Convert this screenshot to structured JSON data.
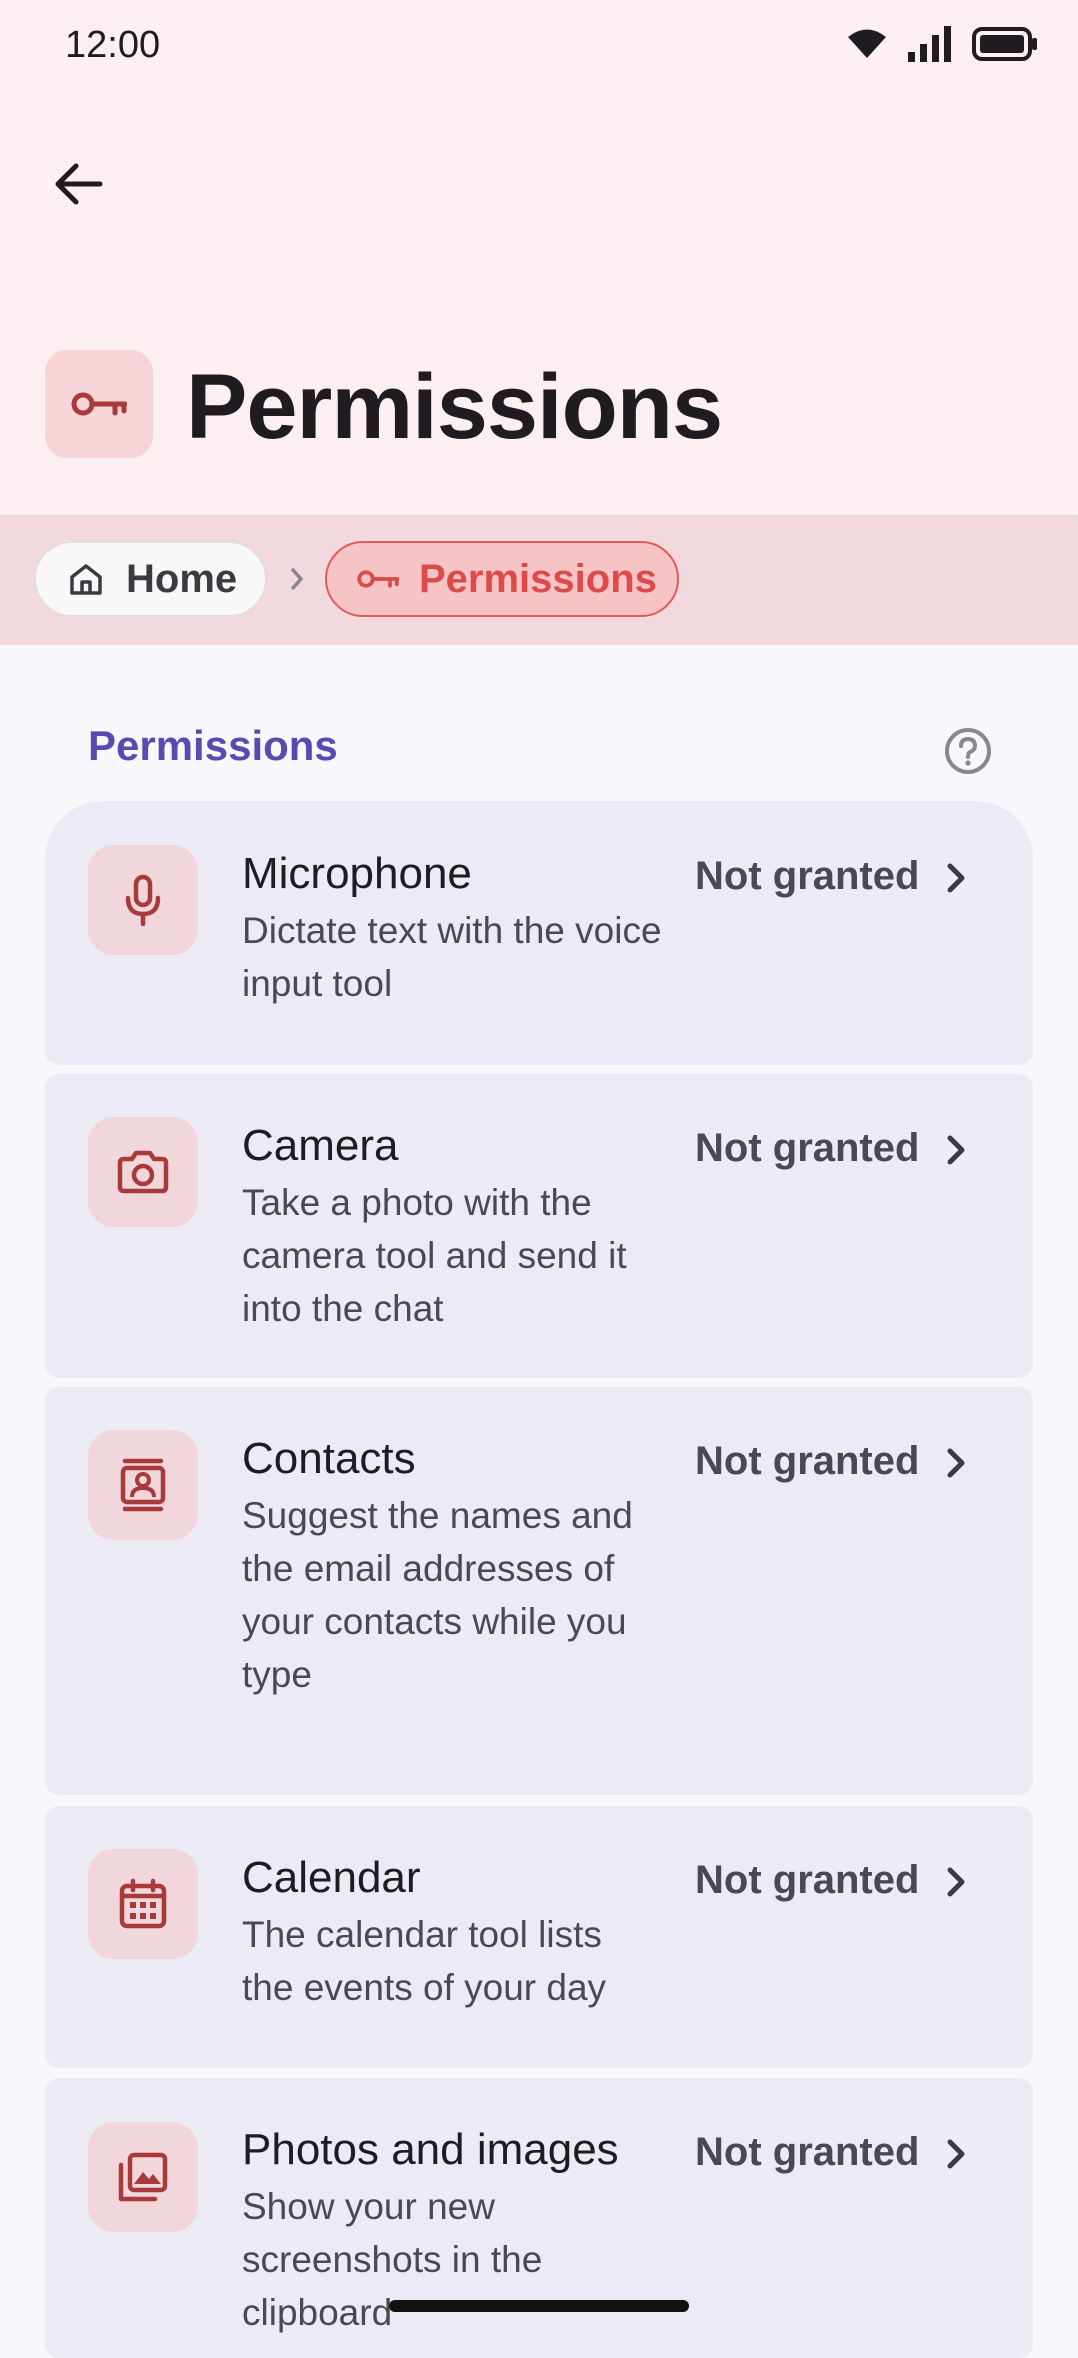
{
  "status_bar": {
    "time": "12:00"
  },
  "header": {
    "title": "Permissions"
  },
  "breadcrumb": {
    "home_label": "Home",
    "current_label": "Permissions"
  },
  "section": {
    "label": "Permissions"
  },
  "permissions": [
    {
      "title": "Microphone",
      "description": "Dictate text with the voice input tool",
      "status": "Not granted",
      "icon": "microphone-icon"
    },
    {
      "title": "Camera",
      "description": "Take a photo with the camera tool and send it into the chat",
      "status": "Not granted",
      "icon": "camera-icon"
    },
    {
      "title": "Contacts",
      "description": "Suggest the names and the email addresses of your contacts while you type",
      "status": "Not granted",
      "icon": "contacts-icon"
    },
    {
      "title": "Calendar",
      "description": "The calendar tool lists the events of your day",
      "status": "Not granted",
      "icon": "calendar-icon"
    },
    {
      "title": "Photos and images",
      "description": "Show your new screenshots in the clipboard",
      "status": "Not granted",
      "icon": "photos-icon"
    }
  ],
  "colors": {
    "accent": "#5a4ab0",
    "brand": "#dd4a4a",
    "icon_color": "#a83a3a"
  }
}
